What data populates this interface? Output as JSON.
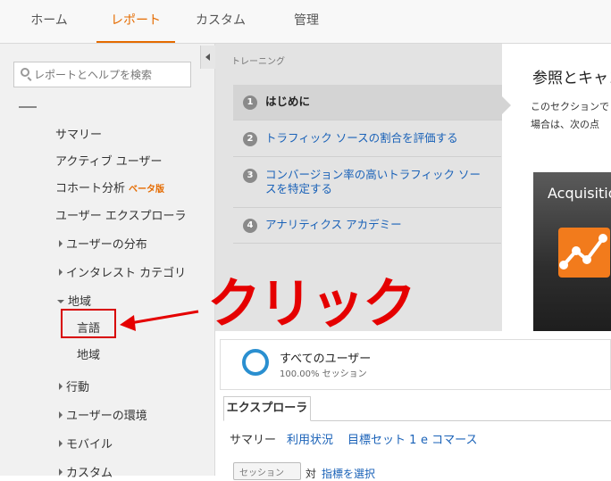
{
  "topnav": {
    "tabs": [
      "ホーム",
      "レポート",
      "カスタム",
      "管理"
    ],
    "active": "レポート"
  },
  "sidebar": {
    "search_placeholder": "レポートとヘルプを検索",
    "items": [
      {
        "label": "サマリー"
      },
      {
        "label": "アクティブ ユーザー"
      },
      {
        "label": "コホート分析",
        "badge": "ベータ版"
      },
      {
        "label": "ユーザー エクスプローラ"
      },
      {
        "label": "ユーザーの分布"
      },
      {
        "label": "インタレスト カテゴリ"
      },
      {
        "label": "地域"
      },
      {
        "label": "言語"
      },
      {
        "label": "地域"
      },
      {
        "label": "行動"
      },
      {
        "label": "ユーザーの環境"
      },
      {
        "label": "モバイル"
      },
      {
        "label": "カスタム"
      }
    ]
  },
  "training": {
    "header": "トレーニング",
    "steps": [
      {
        "num": "1",
        "label": "はじめに"
      },
      {
        "num": "2",
        "label": "トラフィック ソースの割合を評価する"
      },
      {
        "num": "3",
        "label": "コンバージョン率の高いトラフィック ソースを特定する"
      },
      {
        "num": "4",
        "label": "アナリティクス アカデミー"
      }
    ]
  },
  "content": {
    "title": "参照とキャン",
    "desc_line1": "このセクションで",
    "desc_line2": "場合は、次の点",
    "video_title": "Acquisitio"
  },
  "segment": {
    "name": "すべてのユーザー",
    "sub": "100.00% セッション"
  },
  "report_tabs": {
    "active": "エクスプローラ",
    "subtabs": [
      "サマリー",
      "利用状況",
      "目標セット 1",
      "e コマース"
    ]
  },
  "bottom": {
    "dropdown": "セッション",
    "vs": "対",
    "link": "指標を選択"
  },
  "annotation": {
    "text": "クリック",
    "color": "#e50000"
  },
  "colors": {
    "accent": "#e56b00",
    "link": "#1a62b8",
    "highlight": "#d80000"
  }
}
